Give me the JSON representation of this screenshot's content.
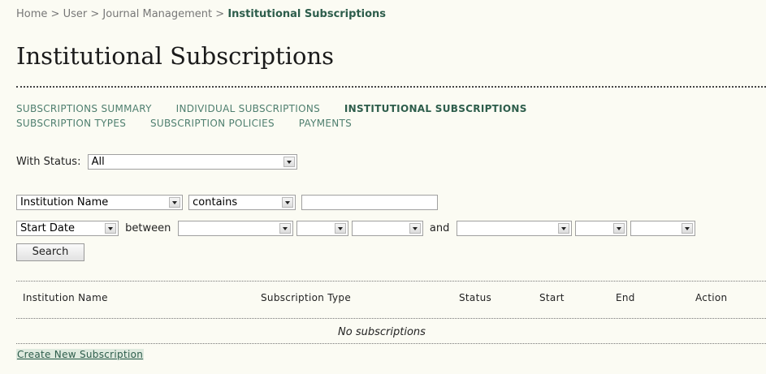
{
  "breadcrumb": {
    "items": [
      "Home",
      "User",
      "Journal Management"
    ],
    "separator": ">",
    "current": "Institutional Subscriptions"
  },
  "page_title": "Institutional Subscriptions",
  "subnav": {
    "items": [
      "Subscriptions Summary",
      "Individual Subscriptions",
      "Institutional Subscriptions",
      "Subscription Types",
      "Subscription Policies",
      "Payments"
    ],
    "active": "Institutional Subscriptions"
  },
  "status_filter": {
    "label": "With Status:",
    "value": "All"
  },
  "search_filter": {
    "field": "Institution Name",
    "match": "contains",
    "value": ""
  },
  "date_filter": {
    "field": "Start Date",
    "between_label": "between",
    "and_label": "and"
  },
  "search_button": "Search",
  "table": {
    "columns": [
      "Institution Name",
      "Subscription Type",
      "Status",
      "Start",
      "End",
      "Action"
    ],
    "empty_message": "No subscriptions"
  },
  "create_link": "Create New Subscription",
  "colors": {
    "accent": "#2d5d4b",
    "link": "#4f7f6f",
    "background": "#fbfbf3"
  }
}
